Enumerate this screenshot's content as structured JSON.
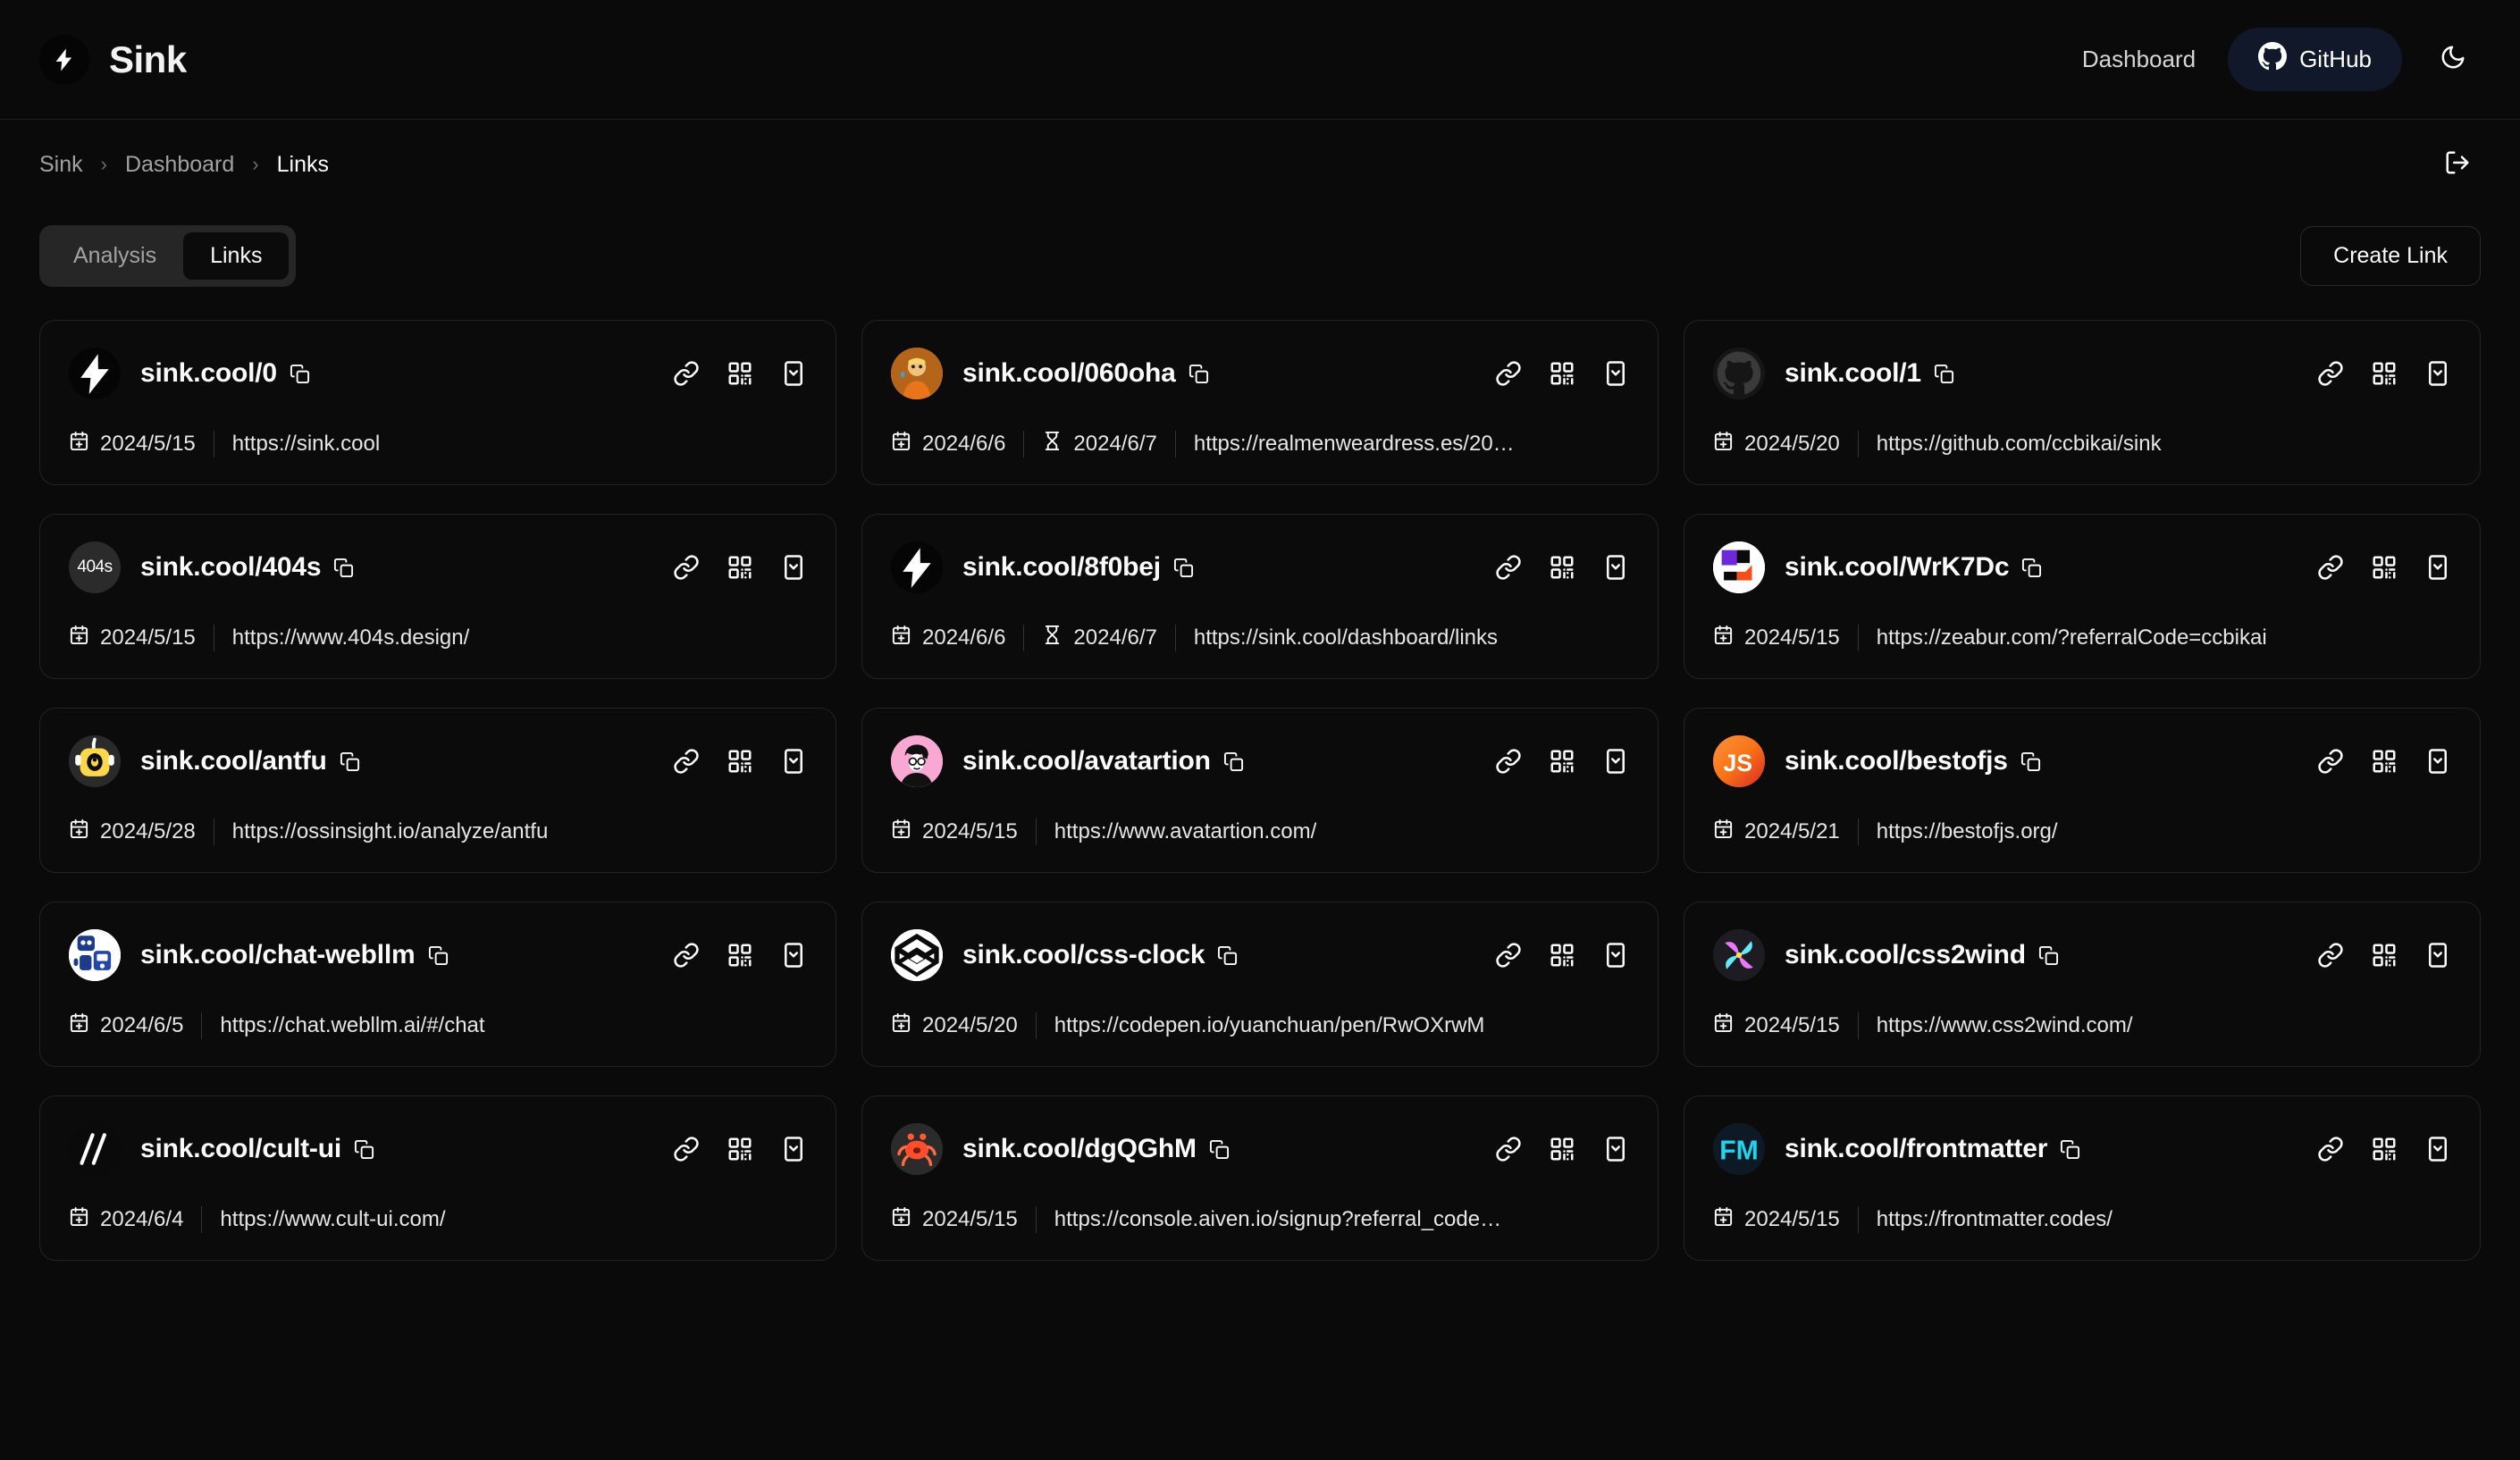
{
  "header": {
    "brand_name": "Sink",
    "brand_icon": "lightning-bolt-icon",
    "nav": {
      "dashboard_label": "Dashboard",
      "github_label": "GitHub",
      "github_icon": "github-icon",
      "theme_icon": "moon-icon"
    }
  },
  "breadcrumb": {
    "items": [
      {
        "label": "Sink",
        "current": false
      },
      {
        "label": "Dashboard",
        "current": false
      },
      {
        "label": "Links",
        "current": true
      }
    ],
    "separator": "›",
    "logout_icon": "logout-icon"
  },
  "toolbar": {
    "tabs": [
      {
        "label": "Analysis",
        "active": false
      },
      {
        "label": "Links",
        "active": true
      }
    ],
    "create_label": "Create Link"
  },
  "card_icons": {
    "copy": "copy-icon",
    "link": "link-icon",
    "qr": "qr-code-icon",
    "more": "chevron-down-box-icon",
    "created": "calendar-plus-icon",
    "expires": "hourglass-icon"
  },
  "links": [
    {
      "slug": "sink.cool/0",
      "created": "2024/5/15",
      "expires": null,
      "url": "https://sink.cool",
      "avatar": "sink-bolt",
      "avatar_bg": "#050505"
    },
    {
      "slug": "sink.cool/060oha",
      "created": "2024/6/6",
      "expires": "2024/6/7",
      "url": "https://realmenweardress.es/20…",
      "avatar": "realmen",
      "avatar_bg": "#c8742a"
    },
    {
      "slug": "sink.cool/1",
      "created": "2024/5/20",
      "expires": null,
      "url": "https://github.com/ccbikai/sink",
      "avatar": "github-dark",
      "avatar_bg": "#161616"
    },
    {
      "slug": "sink.cool/404s",
      "created": "2024/5/15",
      "expires": null,
      "url": "https://www.404s.design/",
      "avatar": "text-404s",
      "avatar_bg": "#2b2b2b"
    },
    {
      "slug": "sink.cool/8f0bej",
      "created": "2024/6/6",
      "expires": "2024/6/7",
      "url": "https://sink.cool/dashboard/links",
      "avatar": "sink-bolt",
      "avatar_bg": "#050505"
    },
    {
      "slug": "sink.cool/WrK7Dc",
      "created": "2024/5/15",
      "expires": null,
      "url": "https://zeabur.com/?referralCode=ccbikai",
      "avatar": "zeabur",
      "avatar_bg": "#ffffff"
    },
    {
      "slug": "sink.cool/antfu",
      "created": "2024/5/28",
      "expires": null,
      "url": "https://ossinsight.io/analyze/antfu",
      "avatar": "antfu",
      "avatar_bg": "#2a2a2a"
    },
    {
      "slug": "sink.cool/avatartion",
      "created": "2024/5/15",
      "expires": null,
      "url": "https://www.avatartion.com/",
      "avatar": "avatartion",
      "avatar_bg": "#f9a8d4"
    },
    {
      "slug": "sink.cool/bestofjs",
      "created": "2024/5/21",
      "expires": null,
      "url": "https://bestofjs.org/",
      "avatar": "bestofjs",
      "avatar_bg": "#f97316"
    },
    {
      "slug": "sink.cool/chat-webllm",
      "created": "2024/6/5",
      "expires": null,
      "url": "https://chat.webllm.ai/#/chat",
      "avatar": "webllm",
      "avatar_bg": "#ffffff"
    },
    {
      "slug": "sink.cool/css-clock",
      "created": "2024/5/20",
      "expires": null,
      "url": "https://codepen.io/yuanchuan/pen/RwOXrwM",
      "avatar": "codepen",
      "avatar_bg": "#ffffff"
    },
    {
      "slug": "sink.cool/css2wind",
      "created": "2024/5/15",
      "expires": null,
      "url": "https://www.css2wind.com/",
      "avatar": "css2wind",
      "avatar_bg": "#1c1c22"
    },
    {
      "slug": "sink.cool/cult-ui",
      "created": "2024/6/4",
      "expires": null,
      "url": "https://www.cult-ui.com/",
      "avatar": "cult-ui",
      "avatar_bg": "#0a0a0a"
    },
    {
      "slug": "sink.cool/dgQGhM",
      "created": "2024/5/15",
      "expires": null,
      "url": "https://console.aiven.io/signup?referral_code…",
      "avatar": "aiven",
      "avatar_bg": "#2b2b2b"
    },
    {
      "slug": "sink.cool/frontmatter",
      "created": "2024/5/15",
      "expires": null,
      "url": "https://frontmatter.codes/",
      "avatar": "frontmatter",
      "avatar_bg": "#0d1a26"
    }
  ]
}
